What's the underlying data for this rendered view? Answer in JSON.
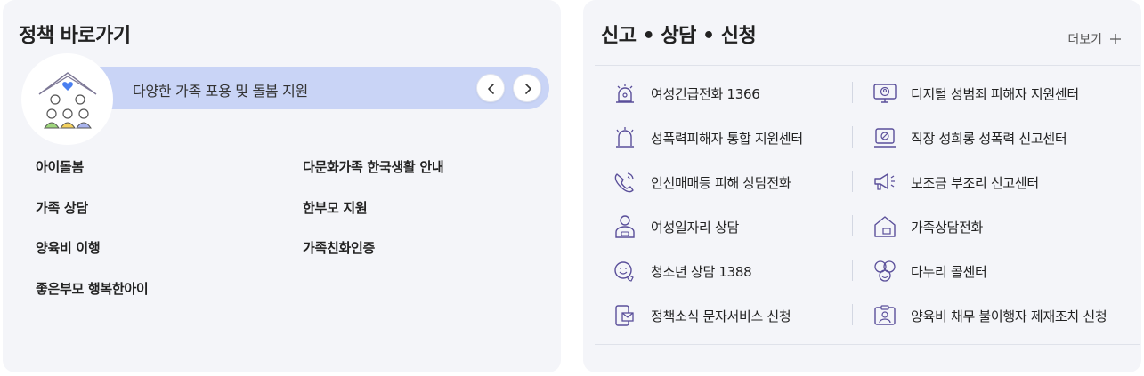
{
  "policy": {
    "title": "정책 바로가기",
    "category": "다양한 가족 포용 및 돌봄 지원",
    "category_icon": "family-house-icon",
    "prev_icon": "chevron-left-icon",
    "next_icon": "chevron-right-icon",
    "links": [
      "아이돌봄",
      "다문화가족 한국생활 안내",
      "가족 상담",
      "한부모 지원",
      "양육비 이행",
      "가족친화인증",
      "좋은부모 행복한아이"
    ]
  },
  "services": {
    "title": "신고 • 상담 • 신청",
    "more_label": "더보기",
    "more_icon": "plus-icon",
    "items": [
      {
        "label": "여성긴급전화 1366",
        "icon": "siren-icon"
      },
      {
        "label": "디지털 성범죄 피해자 지원센터",
        "icon": "monitor-icon"
      },
      {
        "label": "성폭력피해자 통합 지원센터",
        "icon": "alarm-bell-icon"
      },
      {
        "label": "직장 성희롱 성폭력 신고센터",
        "icon": "report-board-icon"
      },
      {
        "label": "인신매매등 피해 상담전화",
        "icon": "phone-call-icon"
      },
      {
        "label": "보조금 부조리 신고센터",
        "icon": "megaphone-icon"
      },
      {
        "label": "여성일자리 상담",
        "icon": "worker-icon"
      },
      {
        "label": "가족상담전화",
        "icon": "home-icon"
      },
      {
        "label": "청소년 상담 1388",
        "icon": "smile-phone-icon"
      },
      {
        "label": "다누리 콜센터",
        "icon": "faces-icon"
      },
      {
        "label": "정책소식 문자서비스 신청",
        "icon": "message-icon"
      },
      {
        "label": "양육비 채무 불이행자 제재조치 신청",
        "icon": "id-card-icon"
      }
    ]
  },
  "colors": {
    "panel_bg": "#f4f5f9",
    "category_bar": "#c9d4f6",
    "icon_stroke": "#5a4f9a",
    "heart": "#4a7ff0"
  }
}
